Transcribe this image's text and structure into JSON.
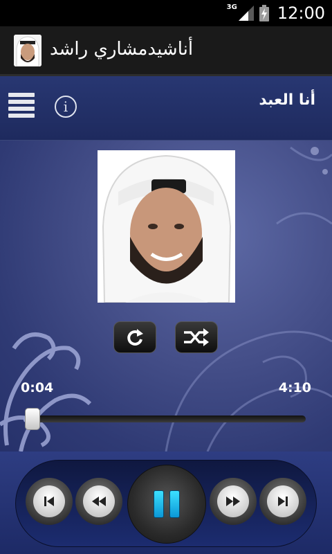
{
  "status_bar": {
    "network": "3G",
    "time": "12:00"
  },
  "action_bar": {
    "title": "أناشيدمشاري راشد"
  },
  "now_playing": {
    "title": "أنا العبد"
  },
  "player": {
    "elapsed": "0:04",
    "duration": "4:10",
    "progress": 0.016
  },
  "colors": {
    "accent": "#1ab8f0",
    "header_bg": "#1a1a1a",
    "panel_bg": "#283772"
  },
  "icons": [
    "menu-icon",
    "info-icon",
    "repeat-icon",
    "shuffle-icon",
    "previous-track-icon",
    "rewind-icon",
    "pause-icon",
    "fast-forward-icon",
    "next-track-icon"
  ]
}
